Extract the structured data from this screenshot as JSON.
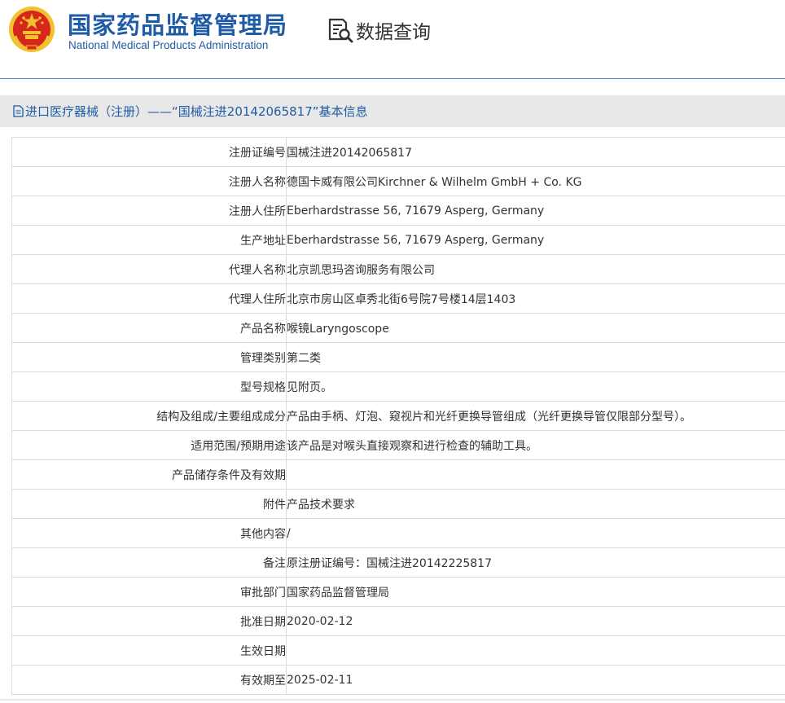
{
  "header": {
    "title_cn": "国家药品监督管理局",
    "title_en": "National Medical Products Administration",
    "query_label": "数据查询"
  },
  "section": {
    "title": "进口医疗器械（注册）——“国械注进20142065817”基本信息"
  },
  "rows": [
    {
      "label": "注册证编号",
      "value": "国械注进20142065817"
    },
    {
      "label": "注册人名称",
      "value": "德国卡威有限公司Kirchner & Wilhelm GmbH + Co. KG"
    },
    {
      "label": "注册人住所",
      "value": "Eberhardstrasse 56, 71679 Asperg, Germany"
    },
    {
      "label": "生产地址",
      "value": "Eberhardstrasse 56, 71679 Asperg, Germany"
    },
    {
      "label": "代理人名称",
      "value": "北京凯思玛咨询服务有限公司"
    },
    {
      "label": "代理人住所",
      "value": "北京市房山区卓秀北街6号院7号楼14层1403"
    },
    {
      "label": "产品名称",
      "value": "喉镜Laryngoscope"
    },
    {
      "label": "管理类别",
      "value": "第二类"
    },
    {
      "label": "型号规格",
      "value": "见附页。"
    },
    {
      "label": "结构及组成/主要组成成分",
      "value": "产品由手柄、灯泡、窥视片和光纤更换导管组成（光纤更换导管仅限部分型号）。"
    },
    {
      "label": "适用范围/预期用途",
      "value": "该产品是对喉头直接观察和进行检查的辅助工具。"
    },
    {
      "label": "产品储存条件及有效期",
      "value": ""
    },
    {
      "label": "附件",
      "value": "产品技术要求"
    },
    {
      "label": "其他内容",
      "value": "/"
    },
    {
      "label": "备注",
      "value": "原注册证编号：国械注进20142225817"
    },
    {
      "label": "审批部门",
      "value": "国家药品监督管理局"
    },
    {
      "label": "批准日期",
      "value": "2020-02-12"
    },
    {
      "label": "生效日期",
      "value": ""
    },
    {
      "label": "有效期至",
      "value": "2025-02-11"
    }
  ],
  "icons": {
    "emblem": "national-emblem-icon",
    "query": "document-search-icon",
    "section": "document-icon"
  },
  "colors": {
    "brand_blue": "#1f5ba6",
    "emblem_red": "#d7261e",
    "emblem_gold": "#f2c12e",
    "section_bg": "#e8e8e8",
    "border": "#dcdcdc"
  }
}
